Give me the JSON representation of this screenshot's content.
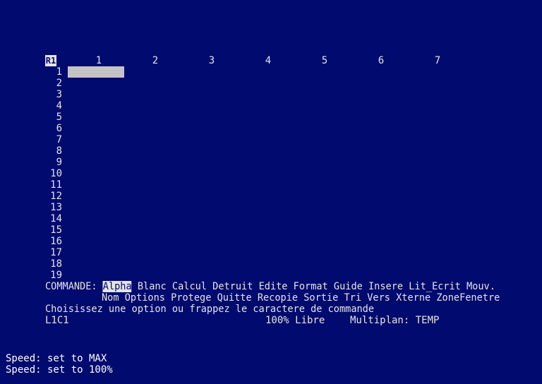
{
  "grid": {
    "corner_label": "R1",
    "columns": [
      "1",
      "2",
      "3",
      "4",
      "5",
      "6",
      "7"
    ],
    "rows": [
      "1",
      "2",
      "3",
      "4",
      "5",
      "6",
      "7",
      "8",
      "9",
      "10",
      "11",
      "12",
      "13",
      "14",
      "15",
      "16",
      "17",
      "18",
      "19"
    ]
  },
  "command": {
    "label": "COMMANDE:",
    "line1": [
      "Alpha",
      "Blanc",
      "Calcul",
      "Detruit",
      "Edite",
      "Format",
      "Guide",
      "Insere",
      "Lit_Ecrit",
      "Mouv."
    ],
    "line2": [
      "Nom",
      "Options",
      "Protege",
      "Quitte",
      "Recopie",
      "Sortie",
      "Tri",
      "Vers",
      "Xterne",
      "ZoneFenetre"
    ],
    "selected": "Alpha",
    "prompt": "Choisissez une option ou frappez le caractere de commande"
  },
  "status": {
    "cell_ref": "L1C1",
    "free": "100% Libre",
    "file": "Multiplan: TEMP"
  },
  "messages": [
    "Speed: set to MAX",
    "Speed: set to 100%"
  ],
  "colors": {
    "background": "#010a6e",
    "text": "#e4e4e4",
    "cursor": "#c4c4c4"
  }
}
